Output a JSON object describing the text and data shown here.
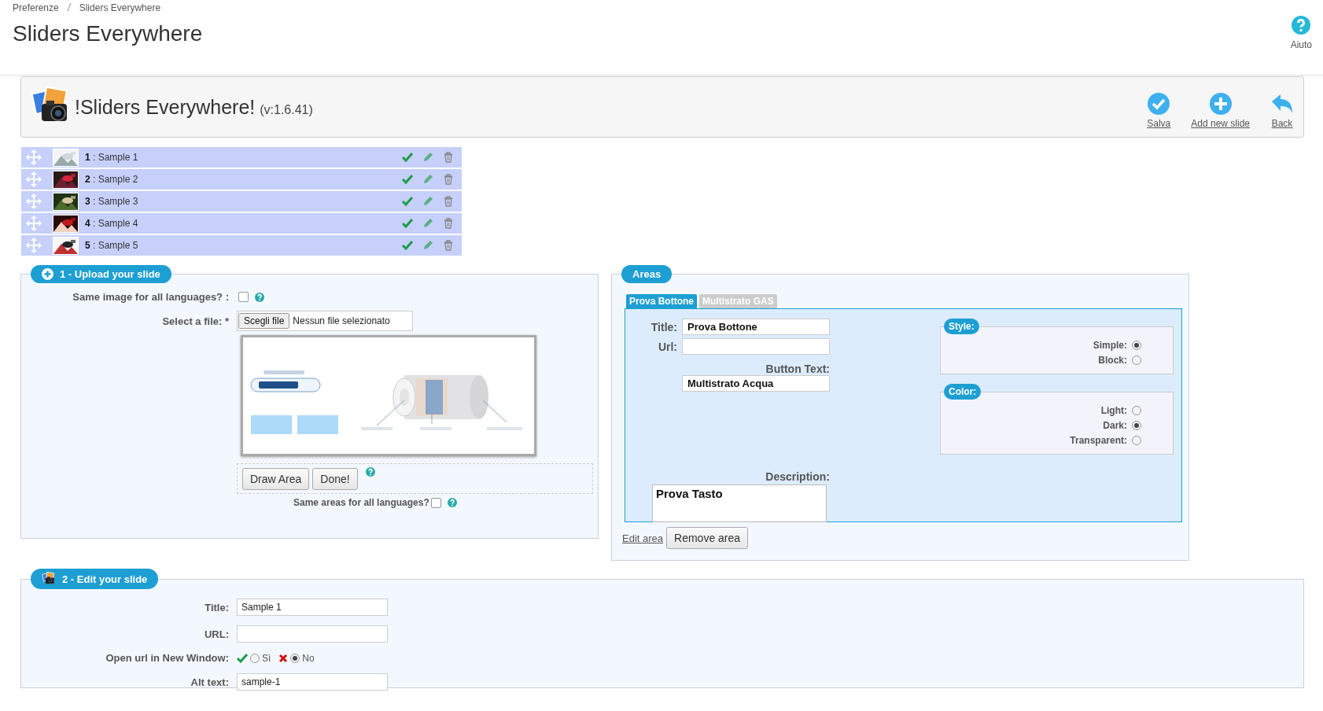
{
  "breadcrumb": [
    "Preferenze",
    "Sliders Everywhere"
  ],
  "page_title": "Sliders Everywhere",
  "help": {
    "label": "Aiuto"
  },
  "module": {
    "title": "!Sliders Everywhere!",
    "version": "(v:1.6.41)",
    "actions": [
      {
        "kind": "save",
        "label": "Salva"
      },
      {
        "kind": "add",
        "label": "Add new slide"
      },
      {
        "kind": "back",
        "label": "Back"
      }
    ]
  },
  "slides": [
    {
      "number": "1",
      "name": ": Sample 1",
      "active": true
    },
    {
      "number": "2",
      "name": ": Sample 2",
      "active": true
    },
    {
      "number": "3",
      "name": ": Sample 3",
      "active": true
    },
    {
      "number": "4",
      "name": ": Sample 4",
      "active": true
    },
    {
      "number": "5",
      "name": ": Sample 5",
      "active": true
    }
  ],
  "upload": {
    "legend": "1 - Upload your slide",
    "same_image": {
      "label": "Same image for all languages? :",
      "checked": false
    },
    "file": {
      "label": "Select a file: *",
      "button": "Scegli file",
      "status": "Nessun file selezionato"
    },
    "preview": {
      "kind": "picture"
    },
    "area_buttons": [
      "Draw Area",
      "Done!"
    ],
    "same_areas": {
      "label": "Same areas for all languages?",
      "checked": false
    }
  },
  "areas": {
    "legend": "Areas",
    "tabs": [
      {
        "label": "Prova Bottone",
        "selected": true
      },
      {
        "label": "Multistrato GAS",
        "selected": false
      }
    ],
    "form": {
      "title_label": "Title:",
      "title_value": "Prova Bottone",
      "url_label": "Url:",
      "button_text_label": "Button Text:",
      "button_text_value": "Multistrato Acqua",
      "description_label": "Description:",
      "description_value": "Prova Tasto"
    },
    "style": {
      "legend": "Style:",
      "options": [
        {
          "label": "Simple:",
          "selected": true
        },
        {
          "label": "Block:",
          "selected": false
        }
      ]
    },
    "color": {
      "legend": "Color:",
      "options": [
        {
          "label": "Light:",
          "selected": false
        },
        {
          "label": "Dark:",
          "selected": true
        },
        {
          "label": "Transparent:",
          "selected": false
        }
      ]
    },
    "edit_link": "Edit area",
    "remove_button": "Remove area"
  },
  "edit": {
    "legend": "2 - Edit your slide",
    "fields": [
      {
        "kind": "text",
        "label": "Title:",
        "value": "Sample 1"
      },
      {
        "kind": "text",
        "label": "URL:"
      },
      {
        "kind": "radio",
        "label": "Open url in New Window:",
        "options": [
          {
            "kind": "yes",
            "label": "Sì",
            "selected": false
          },
          {
            "kind": "no",
            "label": "No",
            "selected": true
          }
        ]
      },
      {
        "kind": "text",
        "label": "Alt text:",
        "value": "sample-1"
      }
    ]
  }
}
